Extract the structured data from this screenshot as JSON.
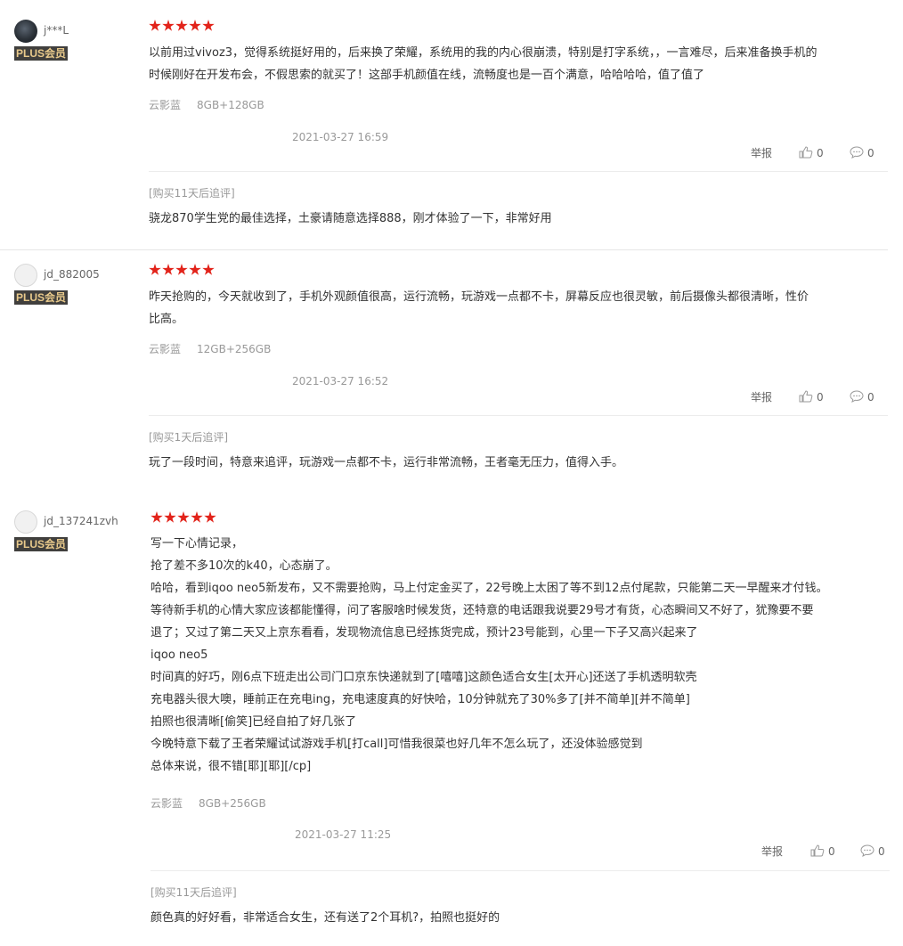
{
  "reviews": [
    {
      "user": {
        "name": "j***L",
        "badge": "PLUS会员"
      },
      "rating": 5,
      "text": [
        "以前用过vivoz3，觉得系统挺好用的，后来换了荣耀，系统用的我的内心很崩溃，特别是打字系统，，一言难尽，后来准备换手机的",
        "时候刚好在开发布会，不假思索的就买了！这部手机颜值在线，流畅度也是一百个满意，哈哈哈哈，值了值了"
      ],
      "spec": {
        "color": "云影蓝",
        "config": "8GB+128GB"
      },
      "date": "2021-03-27 16:59",
      "actions": {
        "report": "举报",
        "likes": "0",
        "comments": "0"
      },
      "append": {
        "label": "[购买11天后追评]",
        "text": "骁龙870学生党的最佳选择，土豪请随意选择888，刚才体验了一下，非常好用"
      }
    },
    {
      "user": {
        "name": "jd_882005",
        "badge": "PLUS会员"
      },
      "rating": 5,
      "text": [
        "昨天抢购的，今天就收到了，手机外观颜值很高，运行流畅，玩游戏一点都不卡，屏幕反应也很灵敏，前后摄像头都很清晰，性价",
        "比高。"
      ],
      "spec": {
        "color": "云影蓝",
        "config": "12GB+256GB"
      },
      "date": "2021-03-27 16:52",
      "actions": {
        "report": "举报",
        "likes": "0",
        "comments": "0"
      },
      "append": {
        "label": "[购买1天后追评]",
        "text": "玩了一段时间，特意来追评，玩游戏一点都不卡，运行非常流畅，王者毫无压力，值得入手。"
      }
    },
    {
      "user": {
        "name": "jd_137241zvh",
        "badge": "PLUS会员"
      },
      "rating": 5,
      "text": [
        "写一下心情记录，",
        "抢了差不多10次的k40，心态崩了。",
        "哈哈，看到iqoo neo5新发布，又不需要抢购，马上付定金买了，22号晚上太困了等不到12点付尾款，只能第二天一早醒来才付钱。",
        "等待新手机的心情大家应该都能懂得，问了客服啥时候发货，还特意的电话跟我说要29号才有货，心态瞬间又不好了，犹豫要不要",
        "退了；又过了第二天又上京东看看，发现物流信息已经拣货完成，预计23号能到，心里一下子又高兴起来了",
        "iqoo neo5",
        "时间真的好巧，刚6点下班走出公司门口京东快递就到了[嘻嘻]这颜色适合女生[太开心]还送了手机透明软壳",
        "充电器头很大噢，睡前正在充电ing，充电速度真的好快哈，10分钟就充了30%多了[并不简单][并不简单]",
        "拍照也很清晰[偷笑]已经自拍了好几张了",
        "今晚特意下载了王者荣耀试试游戏手机[打call]可惜我很菜也好几年不怎么玩了，还没体验感觉到",
        "总体来说，很不错[耶][耶][/cp]"
      ],
      "spec": {
        "color": "云影蓝",
        "config": "8GB+256GB"
      },
      "date": "2021-03-27 11:25",
      "actions": {
        "report": "举报",
        "likes": "0",
        "comments": "0"
      },
      "append": {
        "label": "[购买11天后追评]",
        "text": "颜色真的好好看，非常适合女生，还有送了2个耳机?，拍照也挺好的"
      }
    }
  ],
  "colors": {
    "star": "#e2231a",
    "badge_bg": "#403f3d",
    "badge_text": "#e8c98b",
    "muted": "#999999"
  }
}
